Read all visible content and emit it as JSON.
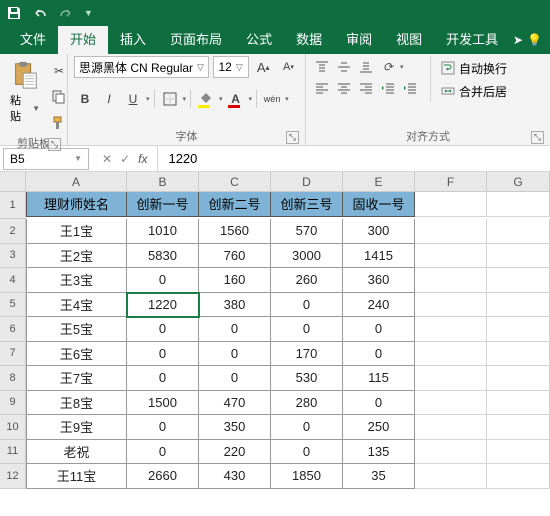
{
  "qat": {
    "save": "save",
    "undo": "undo",
    "redo": "redo"
  },
  "menu": {
    "file": "文件",
    "home": "开始",
    "insert": "插入",
    "layout": "页面布局",
    "formula": "公式",
    "data": "数据",
    "review": "审阅",
    "view": "视图",
    "dev": "开发工具"
  },
  "ribbon": {
    "clipboard": {
      "paste": "粘贴",
      "label": "剪贴板"
    },
    "font": {
      "name": "思源黑体 CN Regular",
      "size": "12",
      "label": "字体"
    },
    "align": {
      "label": "对齐方式",
      "wrap": "自动换行",
      "merge": "合并后居"
    }
  },
  "namebox": "B5",
  "formula_value": "1220",
  "cols": [
    "A",
    "B",
    "C",
    "D",
    "E",
    "F",
    "G"
  ],
  "rownums": [
    "1",
    "2",
    "3",
    "4",
    "5",
    "6",
    "7",
    "8",
    "9",
    "10",
    "11",
    "12"
  ],
  "head": [
    "理财师姓名",
    "创新一号",
    "创新二号",
    "创新三号",
    "固收一号"
  ],
  "rows": [
    [
      "王1宝",
      "1010",
      "1560",
      "570",
      "300"
    ],
    [
      "王2宝",
      "5830",
      "760",
      "3000",
      "1415"
    ],
    [
      "王3宝",
      "0",
      "160",
      "260",
      "360"
    ],
    [
      "王4宝",
      "1220",
      "380",
      "0",
      "240"
    ],
    [
      "王5宝",
      "0",
      "0",
      "0",
      "0"
    ],
    [
      "王6宝",
      "0",
      "0",
      "170",
      "0"
    ],
    [
      "王7宝",
      "0",
      "0",
      "530",
      "115"
    ],
    [
      "王8宝",
      "1500",
      "470",
      "280",
      "0"
    ],
    [
      "王9宝",
      "0",
      "350",
      "0",
      "250"
    ],
    [
      "老祝",
      "0",
      "220",
      "0",
      "135"
    ],
    [
      "王11宝",
      "2660",
      "430",
      "1850",
      "35"
    ]
  ],
  "chart_data": {
    "type": "table",
    "title": "",
    "columns": [
      "理财师姓名",
      "创新一号",
      "创新二号",
      "创新三号",
      "固收一号"
    ],
    "rows": [
      [
        "王1宝",
        1010,
        1560,
        570,
        300
      ],
      [
        "王2宝",
        5830,
        760,
        3000,
        1415
      ],
      [
        "王3宝",
        0,
        160,
        260,
        360
      ],
      [
        "王4宝",
        1220,
        380,
        0,
        240
      ],
      [
        "王5宝",
        0,
        0,
        0,
        0
      ],
      [
        "王6宝",
        0,
        0,
        170,
        0
      ],
      [
        "王7宝",
        0,
        0,
        530,
        115
      ],
      [
        "王8宝",
        1500,
        470,
        280,
        0
      ],
      [
        "王9宝",
        0,
        350,
        0,
        250
      ],
      [
        "老祝",
        0,
        220,
        0,
        135
      ],
      [
        "王11宝",
        2660,
        430,
        1850,
        35
      ]
    ]
  }
}
